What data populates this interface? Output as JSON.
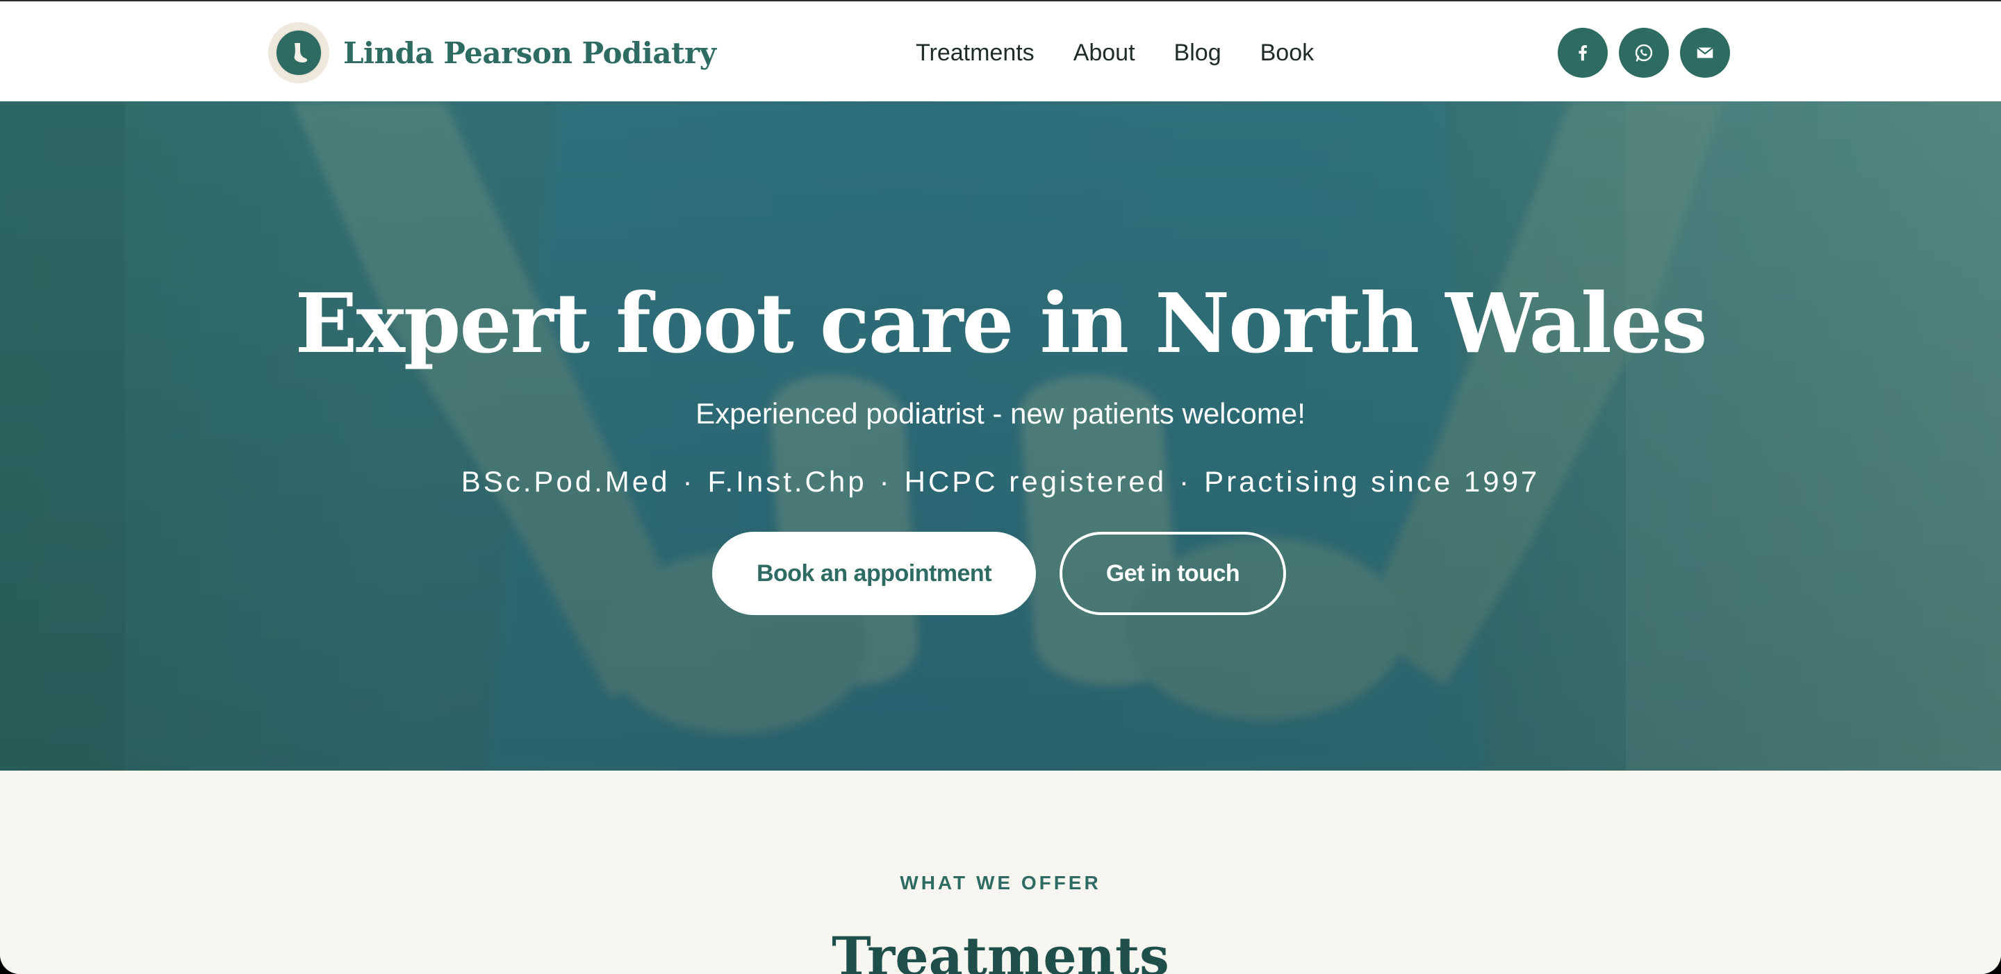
{
  "header": {
    "brand_name": "Linda Pearson Podiatry",
    "nav": [
      "Treatments",
      "About",
      "Blog",
      "Book"
    ],
    "socials": [
      {
        "icon": "facebook-icon"
      },
      {
        "icon": "whatsapp-icon"
      },
      {
        "icon": "email-icon"
      }
    ]
  },
  "hero": {
    "title": "Expert foot care in North Wales",
    "subtitle": "Experienced podiatrist - new patients welcome!",
    "credentials": [
      "BSc.Pod.Med",
      "F.Inst.Chp",
      "HCPC registered",
      "Practising since 1997"
    ],
    "credential_separator": "·",
    "primary_cta": "Book an appointment",
    "secondary_cta": "Get in touch"
  },
  "offer": {
    "eyebrow": "WHAT WE OFFER",
    "title": "Treatments"
  },
  "colors": {
    "brand": "#2d6b63",
    "hero_overlay": "#2f6a70",
    "background": "#f8f6f1",
    "white": "#ffffff"
  }
}
